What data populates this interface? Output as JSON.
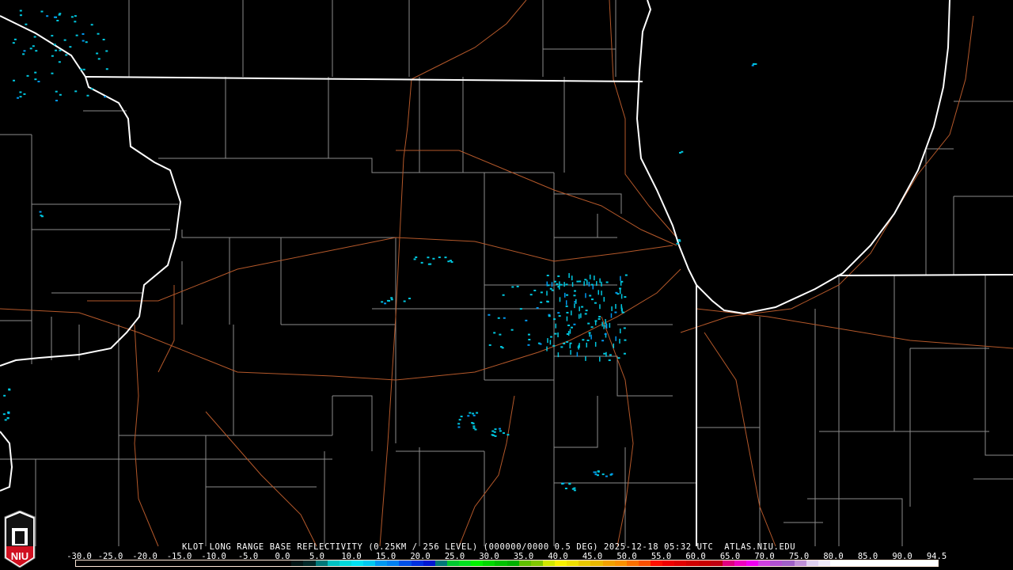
{
  "product_title": "KLOT LONG RANGE BASE REFLECTIVITY (0.25KM / 256 LEVEL) (000000/0000 0.5 DEG) 2025-12-18 05:32 UTC  ATLAS.NIU.EDU",
  "logo_text": "NIU",
  "legend": {
    "labels": [
      "-30.0",
      "-25.0",
      "-20.0",
      "-15.0",
      "-10.0",
      "-5.0",
      "0.0",
      "5.0",
      "10.0",
      "15.0",
      "20.0",
      "25.0",
      "30.0",
      "35.0",
      "40.0",
      "45.0",
      "50.0",
      "55.0",
      "60.0",
      "65.0",
      "70.0",
      "75.0",
      "80.0",
      "85.0",
      "90.0",
      "94.5"
    ],
    "colors": [
      "#000000",
      "#000000",
      "#000000",
      "#000000",
      "#000000",
      "#000000",
      "#000000",
      "#000000",
      "#000000",
      "#000000",
      "#000000",
      "#000000",
      "#000000",
      "#000000",
      "#000000",
      "#000000",
      "#000000",
      "#000000",
      "#001414",
      "#002828",
      "#007878",
      "#00c0c0",
      "#00d8d8",
      "#00e0f0",
      "#00c8f0",
      "#0098f0",
      "#0080f0",
      "#0050e8",
      "#0030e0",
      "#0018d0",
      "#007878",
      "#00c830",
      "#00e020",
      "#00f000",
      "#00d800",
      "#00c000",
      "#00b000",
      "#60c000",
      "#80c800",
      "#d0e800",
      "#f8f000",
      "#f0e000",
      "#e8c800",
      "#e8b800",
      "#f0a000",
      "#f89000",
      "#f87000",
      "#f85000",
      "#ff1000",
      "#f00000",
      "#e00000",
      "#d00000",
      "#c80000",
      "#c00010",
      "#e00080",
      "#f000c0",
      "#f000f0",
      "#d040e0",
      "#b050d0",
      "#a060c8",
      "#c090d8",
      "#e0d0f0",
      "#f0e8f8",
      "#ffffff",
      "#ffffff",
      "#ffffff",
      "#ffffff",
      "#ffffff",
      "#ffffff",
      "#ffffff",
      "#ffffff",
      "#ffffff"
    ]
  },
  "map_colors": {
    "background": "#000000",
    "state_border": "#ffffff",
    "county_line": "#8c8c8c",
    "road": "#b4582a",
    "echo": "#00c8e0"
  }
}
